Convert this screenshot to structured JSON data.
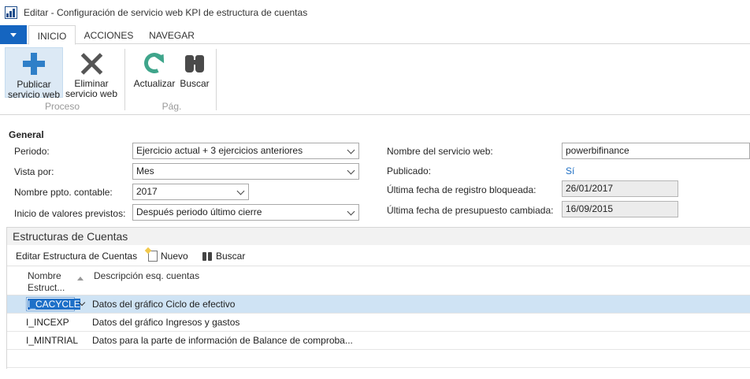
{
  "window": {
    "title": "Editar - Configuración de servicio web KPI de estructura de cuentas"
  },
  "ribbon": {
    "tabs": [
      "INICIO",
      "ACCIONES",
      "NAVEGAR"
    ],
    "buttons": {
      "publicar": "Publicar servicio web",
      "publicar_l1": "Publicar",
      "publicar_l2": "servicio web",
      "eliminar_l1": "Eliminar",
      "eliminar_l2": "servicio web",
      "actualizar": "Actualizar",
      "buscar": "Buscar"
    },
    "groups": {
      "proceso": "Proceso",
      "pag": "Pág."
    }
  },
  "general": {
    "title": "General",
    "fields": {
      "periodo_label": "Periodo:",
      "periodo_value": "Ejercicio actual + 3 ejercicios anteriores",
      "vista_label": "Vista por:",
      "vista_value": "Mes",
      "ppto_label": "Nombre ppto. contable:",
      "ppto_value": "2017",
      "inicio_label": "Inicio de valores previstos:",
      "inicio_value": "Después periodo último cierre",
      "servicio_label": "Nombre del servicio web:",
      "servicio_value": "powerbifinance",
      "publicado_label": "Publicado:",
      "publicado_value": "Sí",
      "registro_label": "Última fecha de registro bloqueada:",
      "registro_value": "26/01/2017",
      "presupuesto_label": "Última fecha de presupuesto cambiada:",
      "presupuesto_value": "16/09/2015"
    }
  },
  "estructuras": {
    "title": "Estructuras de Cuentas",
    "toolbar": {
      "editar": "Editar Estructura de Cuentas",
      "nuevo": "Nuevo",
      "buscar": "Buscar"
    },
    "columns": {
      "nombre_l1": "Nombre",
      "nombre_l2": "Estruct...",
      "descripcion": "Descripción esq. cuentas"
    },
    "rows": [
      {
        "name": "I_CACYCLE",
        "desc": "Datos del gráfico Ciclo de efectivo"
      },
      {
        "name": "I_INCEXP",
        "desc": "Datos del gráfico Ingresos y gastos"
      },
      {
        "name": "I_MINTRIAL",
        "desc": "Datos para la parte de información de Balance de comproba..."
      }
    ]
  },
  "colors": {
    "accent": "#1565c0",
    "selection": "#cfe3f4",
    "link": "#1e6fc4"
  }
}
